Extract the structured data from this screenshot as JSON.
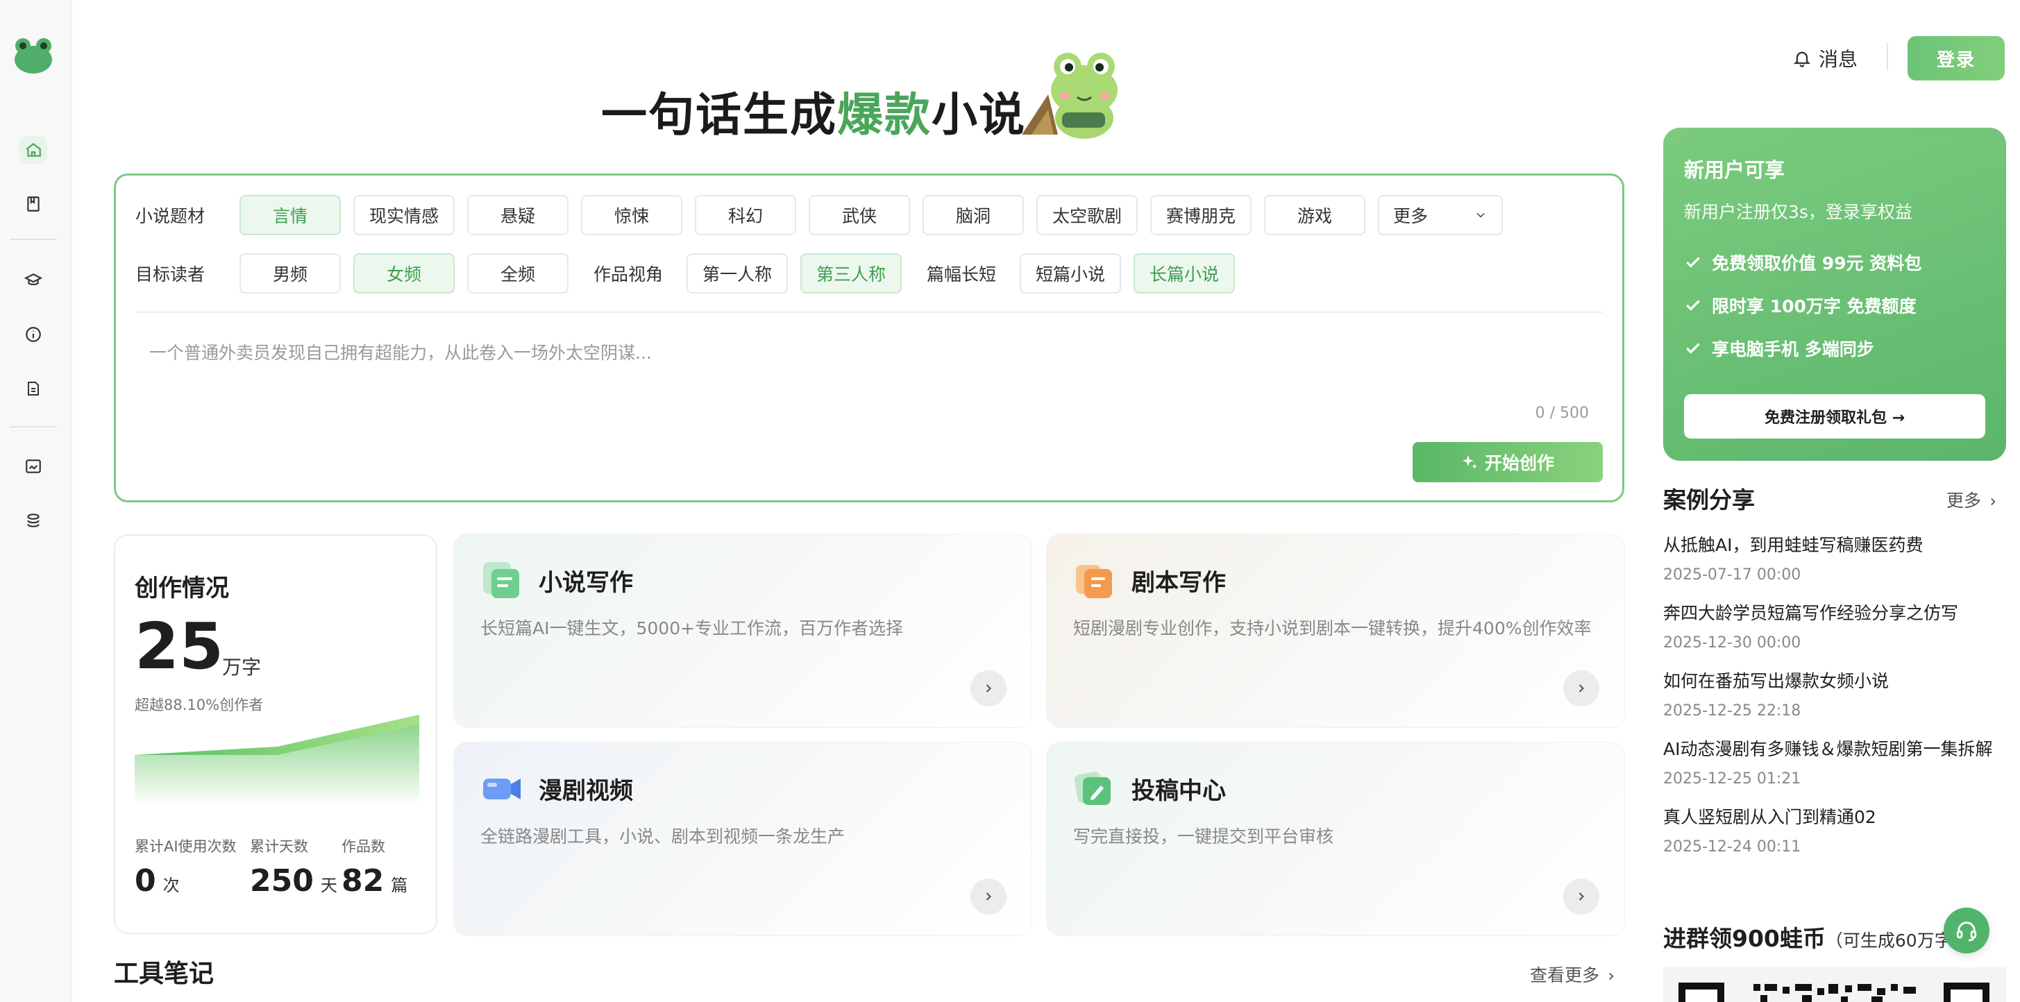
{
  "brand": {
    "accent": "#4aa65a",
    "accent_light": "#ecf7ee",
    "promo_bg": "#6ac076"
  },
  "rail": {
    "logo": "frog-logo",
    "items": [
      {
        "icon": "home-icon",
        "active": true
      },
      {
        "icon": "book-icon",
        "active": false
      },
      {
        "icon": "graduation-cap-icon",
        "active": false
      },
      {
        "icon": "info-icon",
        "active": false
      },
      {
        "icon": "document-icon",
        "active": false
      },
      {
        "icon": "image-edit-icon",
        "active": false
      },
      {
        "icon": "layers-icon",
        "active": false
      }
    ]
  },
  "header": {
    "title_pre": "一句话生成",
    "title_hl": "爆款",
    "title_post": "小说",
    "messages_label": "消息",
    "login_label": "登录"
  },
  "generator": {
    "genre_label": "小说题材",
    "genres": [
      "言情",
      "现实情感",
      "悬疑",
      "惊悚",
      "科幻",
      "武侠",
      "脑洞",
      "太空歌剧",
      "赛博朋克",
      "游戏"
    ],
    "genre_selected": "言情",
    "more_label": "更多",
    "reader_label": "目标读者",
    "readers": [
      "男频",
      "女频",
      "全频"
    ],
    "reader_selected": "女频",
    "pov_label": "作品视角",
    "povs": [
      "第一人称",
      "第三人称"
    ],
    "pov_selected": "第三人称",
    "length_label": "篇幅长短",
    "lengths": [
      "短篇小说",
      "长篇小说"
    ],
    "length_selected": "长篇小说",
    "placeholder": "一个普通外卖员发现自己拥有超能力，从此卷入一场外太空阴谋...",
    "counter": "0 / 500",
    "start_label": "开始创作"
  },
  "stats": {
    "title": "创作情况",
    "words": "25",
    "words_unit": "万字",
    "beat": "超越88.10%创作者",
    "ai_uses_label": "累计AI使用次数",
    "ai_uses": "0",
    "ai_uses_unit": "次",
    "days_label": "累计天数",
    "days": "250",
    "days_unit": "天",
    "works_label": "作品数",
    "works": "82",
    "works_unit": "篇"
  },
  "features": [
    {
      "name": "小说写作",
      "desc": "长短篇AI一键生文，5000+专业工作流，百万作者选择",
      "icon": "novel-writing-icon"
    },
    {
      "name": "剧本写作",
      "desc": "短剧漫剧专业创作，支持小说到剧本一键转换，提升400%创作效率",
      "icon": "script-writing-icon"
    },
    {
      "name": "漫剧视频",
      "desc": "全链路漫剧工具，小说、剧本到视频一条龙生产",
      "icon": "video-camera-icon"
    },
    {
      "name": "投稿中心",
      "desc": "写完直接投，一键提交到平台审核",
      "icon": "submit-pencil-icon"
    }
  ],
  "tools": {
    "title": "工具笔记",
    "more": "查看更多"
  },
  "promo": {
    "title": "新用户可享",
    "subtitle": "新用户注册仅3s，登录享权益",
    "points": [
      "免费领取价值 99元 资料包",
      "限时享 100万字 免费额度",
      "享电脑手机 多端同步"
    ],
    "cta": "免费注册领取礼包 →"
  },
  "cases": {
    "title": "案例分享",
    "more": "更多",
    "items": [
      {
        "title": "从抵触AI，到用蛙蛙写稿赚医药费",
        "date": "2025-07-17 00:00"
      },
      {
        "title": "奔四大龄学员短篇写作经验分享之仿写",
        "date": "2025-12-30 00:00"
      },
      {
        "title": "如何在番茄写出爆款女频小说",
        "date": "2025-12-25 22:18"
      },
      {
        "title": "AI动态漫剧有多赚钱＆爆款短剧第一集拆解",
        "date": "2025-12-25 01:21"
      },
      {
        "title": "真人竖短剧从入门到精通02",
        "date": "2025-12-24 00:11"
      }
    ]
  },
  "group": {
    "title": "进群领900蛙币",
    "note": "（可生成60万字"
  }
}
